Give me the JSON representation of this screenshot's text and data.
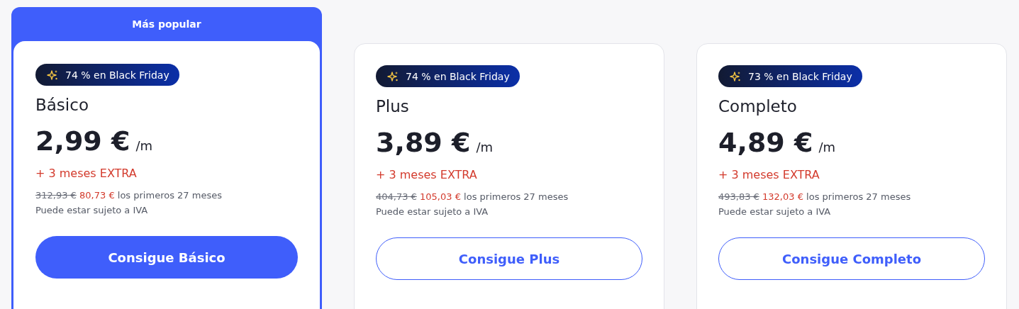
{
  "plans": [
    {
      "ribbon": "Más popular",
      "featured": true,
      "badge": "74 % en Black Friday",
      "name": "Básico",
      "price": "2,99 €",
      "period": "/m",
      "extra": "+ 3 meses EXTRA",
      "old_price": "312,93 €",
      "new_price": "80,73 €",
      "term": "los primeros 27 meses",
      "tax_note": "Puede estar sujeto a IVA",
      "button": "Consigue Básico"
    },
    {
      "featured": false,
      "badge": "74 % en Black Friday",
      "name": "Plus",
      "price": "3,89 €",
      "period": "/m",
      "extra": "+ 3 meses EXTRA",
      "old_price": "404,73 €",
      "new_price": "105,03 €",
      "term": "los primeros 27 meses",
      "tax_note": "Puede estar sujeto a IVA",
      "button": "Consigue Plus"
    },
    {
      "featured": false,
      "badge": "73 % en Black Friday",
      "name": "Completo",
      "price": "4,89 €",
      "period": "/m",
      "extra": "+ 3 meses EXTRA",
      "old_price": "493,83 €",
      "new_price": "132,03 €",
      "term": "los primeros 27 meses",
      "tax_note": "Puede estar sujeto a IVA",
      "button": "Consigue Completo"
    }
  ]
}
